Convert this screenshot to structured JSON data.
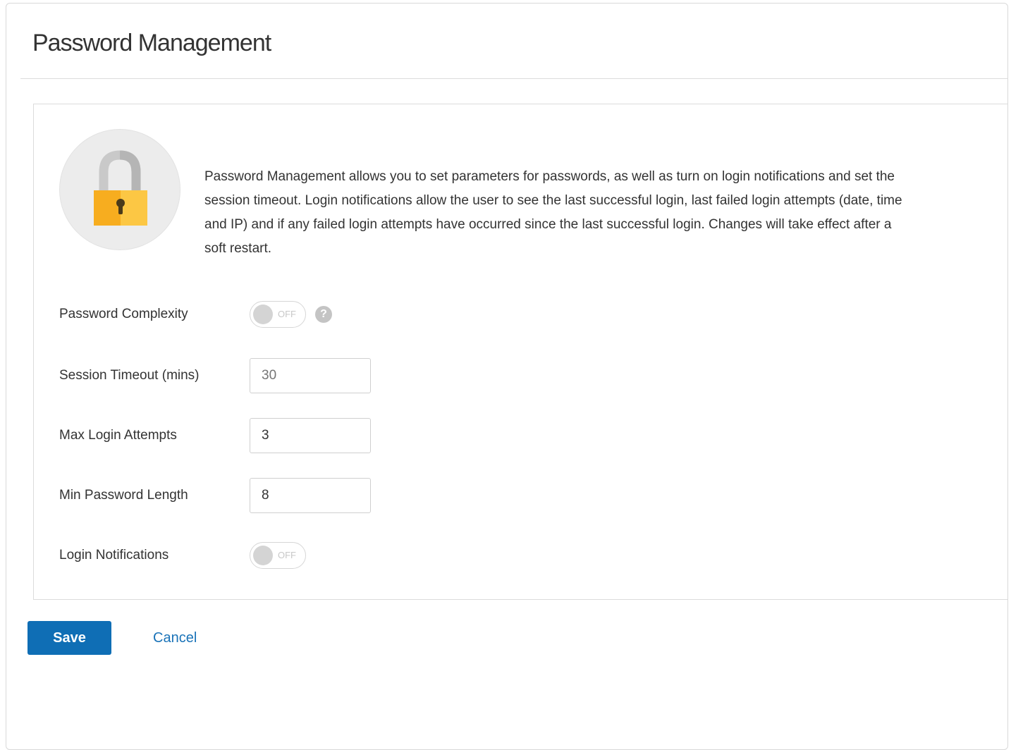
{
  "page": {
    "title": "Password Management"
  },
  "intro": {
    "icon": "padlock-icon",
    "description": "Password Management allows you to set parameters for passwords, as well as turn on login notifications and set the session timeout. Login notifications allow the user to see the last successful login, last failed login attempts (date, time and IP) and if any failed login attempts have occurred since the last successful login. Changes will take effect after a soft restart."
  },
  "form": {
    "password_complexity": {
      "label": "Password Complexity",
      "state": "OFF",
      "help_icon": "question-mark-icon",
      "help_glyph": "?"
    },
    "session_timeout": {
      "label": "Session Timeout (mins)",
      "placeholder": "30"
    },
    "max_login_attempts": {
      "label": "Max Login Attempts",
      "value": "3"
    },
    "min_password_length": {
      "label": "Min Password Length",
      "value": "8"
    },
    "login_notifications": {
      "label": "Login Notifications",
      "state": "OFF"
    }
  },
  "actions": {
    "save_label": "Save",
    "cancel_label": "Cancel"
  },
  "colors": {
    "primary": "#0f6eb5",
    "link": "#1a73b8",
    "lock_body": "#f7b529",
    "lock_body_light": "#fcca4a",
    "lock_shackle": "#c7c7c7"
  }
}
